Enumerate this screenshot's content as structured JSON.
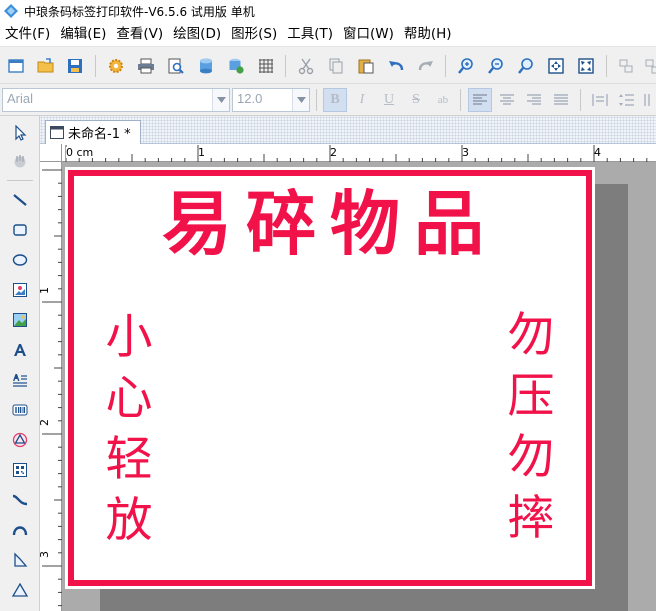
{
  "window": {
    "title": "中琅条码标签打印软件-V6.5.6 试用版 单机"
  },
  "menu": [
    {
      "label": "文件(F)"
    },
    {
      "label": "编辑(E)"
    },
    {
      "label": "查看(V)"
    },
    {
      "label": "绘图(D)"
    },
    {
      "label": "图形(S)"
    },
    {
      "label": "工具(T)"
    },
    {
      "label": "窗口(W)"
    },
    {
      "label": "帮助(H)"
    }
  ],
  "format_toolbar": {
    "font_family": "Arial",
    "font_size": "12.0",
    "bold": "B",
    "italic": "I",
    "underline": "U",
    "strike": "S",
    "special": "ab"
  },
  "document_tab": {
    "label": "未命名-1 *"
  },
  "ruler": {
    "unit_label": "0 cm",
    "h_ticks": [
      "1",
      "2",
      "3",
      "4"
    ],
    "v_ticks": [
      "1",
      "2",
      "3"
    ]
  },
  "label": {
    "title": "易碎物品",
    "left_column": [
      "小",
      "心",
      "轻",
      "放"
    ],
    "right_column": [
      "勿",
      "压",
      "勿",
      "摔"
    ]
  },
  "colors": {
    "label_red": "#f2124a",
    "canvas_gray": "#ababab",
    "shadow_gray": "#7d7d7d",
    "toolbar_bg": "#f0f0f0"
  },
  "icons": {
    "toolbar": [
      "new-doc-icon",
      "open-folder-icon",
      "save-icon",
      "settings-gear-icon",
      "print-icon",
      "print-preview-icon",
      "database-icon",
      "database-settings-icon",
      "grid-icon",
      "cut-icon",
      "copy-icon",
      "paste-icon",
      "undo-icon",
      "redo-icon",
      "zoom-in-icon",
      "zoom-out-icon",
      "zoom-fit-icon",
      "zoom-page-icon",
      "zoom-actual-icon",
      "group-icon",
      "ungroup-icon"
    ],
    "left": [
      "select-arrow-icon",
      "pan-icon",
      "line-icon",
      "rectangle-icon",
      "ellipse-icon",
      "image-icon",
      "picture-icon",
      "text-icon",
      "rich-text-icon",
      "barcode-icon",
      "shape-icon",
      "qrcode-icon",
      "curve-icon",
      "arc-icon",
      "polyline-icon",
      "triangle-icon"
    ]
  }
}
